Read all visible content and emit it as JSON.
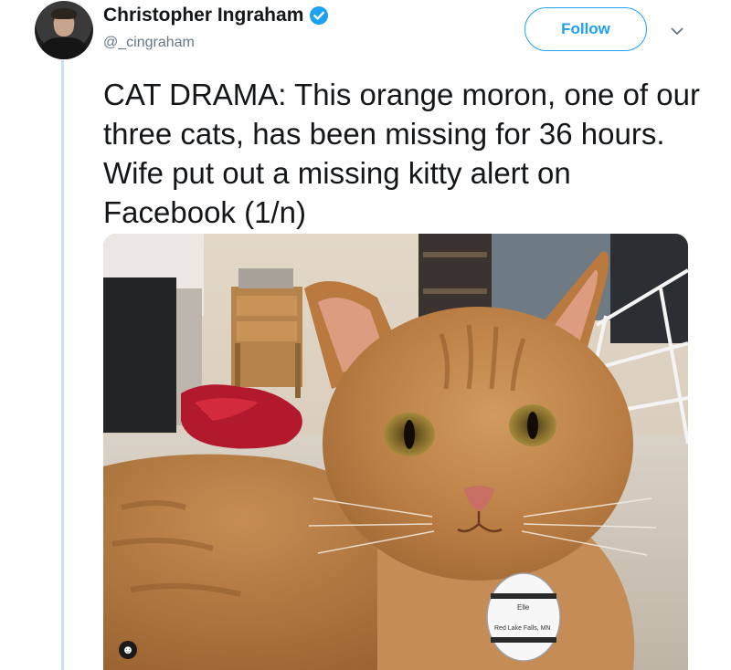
{
  "tweet": {
    "author": {
      "display_name": "Christopher Ingraham",
      "handle": "@_cingraham",
      "verified": true
    },
    "follow_label": "Follow",
    "text": "CAT DRAMA: This orange moron, one of our three cats, has been missing for 36 hours. Wife put out a missing kitty alert on Facebook (1/n)",
    "media": {
      "tag_line1": "Elle",
      "tag_line2": "Red Lake Falls, MN"
    }
  },
  "colors": {
    "accent": "#1da1f2",
    "thread_line": "#c4e2f5",
    "text": "#14171a",
    "secondary_text": "#657786"
  },
  "icons": {
    "verified": "verified-badge-icon",
    "caret": "chevron-down-icon",
    "media_badge": "circle-icon"
  }
}
